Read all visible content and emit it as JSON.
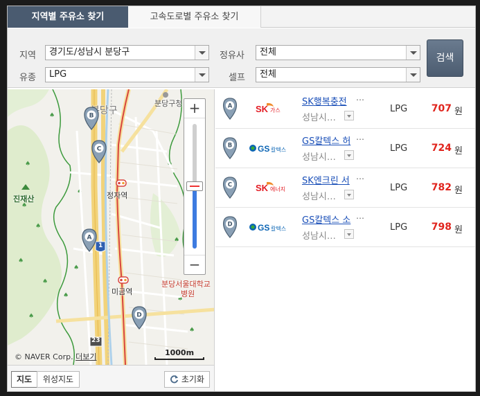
{
  "tabs": [
    {
      "label": "지역별 주유소 찾기",
      "active": true
    },
    {
      "label": "고속도로별 주유소 찾기",
      "active": false
    }
  ],
  "form": {
    "region_label": "지역",
    "region_value": "경기도/성남시 분당구",
    "fuel_label": "유종",
    "fuel_value": "LPG",
    "brand_label": "정유사",
    "brand_value": "전체",
    "self_label": "셀프",
    "self_value": "전체",
    "search_label": "검색"
  },
  "map": {
    "labels": {
      "bundang_gu": "분당구",
      "bundang_gucheong": "분당구청",
      "jinjaesan": "진재산",
      "jeongja_station": "정자역",
      "migeum_station": "미금역",
      "hospital_line1": "분당서울대학교",
      "hospital_line2": "병원",
      "route_1": "1",
      "route_23": "23"
    },
    "markers": [
      "A",
      "B",
      "C",
      "D"
    ],
    "zoom_in": "+",
    "zoom_out": "−",
    "zoom_level": 0.5,
    "copyright": "© NAVER Corp.",
    "more_link": "더보기",
    "scale": "1000m",
    "buttons": {
      "map": "지도",
      "satellite": "위성지도",
      "reset": "초기화"
    }
  },
  "results": [
    {
      "marker": "A",
      "brand": "SK가스",
      "brand_main": "SK",
      "brand_sub": "가스",
      "name": "SK행복충전",
      "more": "…",
      "location": "성남시…",
      "fuel": "LPG",
      "price": "707",
      "unit": "원"
    },
    {
      "marker": "B",
      "brand": "GS칼텍스",
      "brand_main": "GS",
      "brand_sub": "칼텍스",
      "name": "GS칼텍스 허",
      "more": "…",
      "location": "성남시…",
      "fuel": "LPG",
      "price": "724",
      "unit": "원"
    },
    {
      "marker": "C",
      "brand": "SK에너지",
      "brand_main": "SK",
      "brand_sub": "에너지",
      "name": "SK엔크린 서",
      "more": "…",
      "location": "성남시…",
      "fuel": "LPG",
      "price": "782",
      "unit": "원"
    },
    {
      "marker": "D",
      "brand": "GS칼텍스",
      "brand_main": "GS",
      "brand_sub": "칼텍스",
      "name": "GS칼텍스 소",
      "more": "…",
      "location": "성남시…",
      "fuel": "LPG",
      "price": "798",
      "unit": "원"
    }
  ],
  "colors": {
    "tab_active": "#4a5b70",
    "price": "#e0241d",
    "link": "#1a4fb8",
    "sk_red": "#e31b23",
    "gs_blue": "#0a64b4",
    "gs_green": "#3aaa35",
    "marker": "#7f93a6"
  }
}
